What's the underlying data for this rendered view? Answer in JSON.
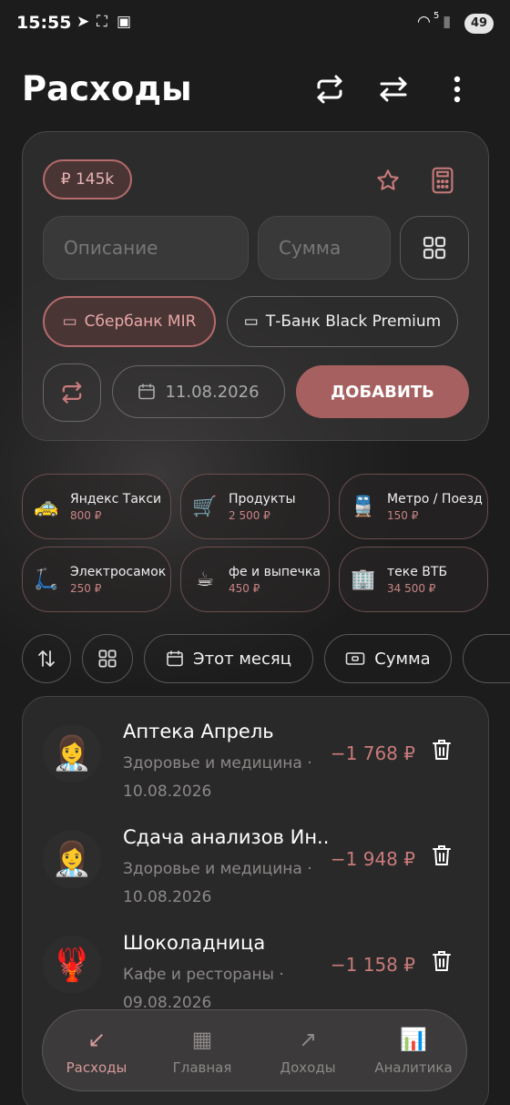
{
  "status": {
    "time": "15:55",
    "wifi": "5",
    "battery": "49"
  },
  "header": {
    "title": "Расходы",
    "icons": [
      "repeat-icon",
      "transfer-icon",
      "more-vert-icon"
    ]
  },
  "form": {
    "budget": "₽ 145k",
    "description_placeholder": "Описание",
    "amount_placeholder": "Сумма",
    "accounts": [
      {
        "label": "Сбербанк MIR",
        "active": true
      },
      {
        "label": "Т-Банк Black Premium",
        "active": false
      }
    ],
    "date": "11.08.2026",
    "add_label": "ДОБАВИТЬ"
  },
  "quick": [
    {
      "name": "Яндекс Такси",
      "amount": "800 ₽",
      "icon": "🚕"
    },
    {
      "name": "Продукты",
      "amount": "2 500 ₽",
      "icon": "🛒"
    },
    {
      "name": "Метро / Поезд",
      "amount": "150 ₽",
      "icon": "🚆"
    },
    {
      "name": "Электросамок",
      "amount": "250 ₽",
      "icon": "🛴"
    },
    {
      "name": "фе и выпечка",
      "amount": "450 ₽",
      "icon": "☕"
    },
    {
      "name": "теке ВТБ",
      "amount": "34 500 ₽",
      "icon": "🏢"
    }
  ],
  "filters": {
    "period": "Этот месяц",
    "sum": "Сумма"
  },
  "transactions": [
    {
      "title": "Аптека Апрель",
      "category": "Здоровье и медицина ·",
      "date": "10.08.2026",
      "amount": "−1 768 ₽",
      "icon": "👩‍⚕️"
    },
    {
      "title": "Сдача анализов Ин...",
      "category": "Здоровье и медицина ·",
      "date": "10.08.2026",
      "amount": "−1 948 ₽",
      "icon": "👩‍⚕️"
    },
    {
      "title": "Шоколадница",
      "category": "Кафе и рестораны ·",
      "date": "09.08.2026",
      "amount": "−1 158 ₽",
      "icon": "🦞"
    }
  ],
  "nav": [
    {
      "label": "Расходы",
      "icon": "↙",
      "active": true
    },
    {
      "label": "Главная",
      "icon": "▦",
      "active": false
    },
    {
      "label": "Доходы",
      "icon": "↗",
      "active": false
    },
    {
      "label": "Аналитика",
      "icon": "📊",
      "active": false
    }
  ],
  "colors": {
    "accent": "#a66060",
    "accent_text": "#c97a7a",
    "background": "#1c1c1c"
  }
}
